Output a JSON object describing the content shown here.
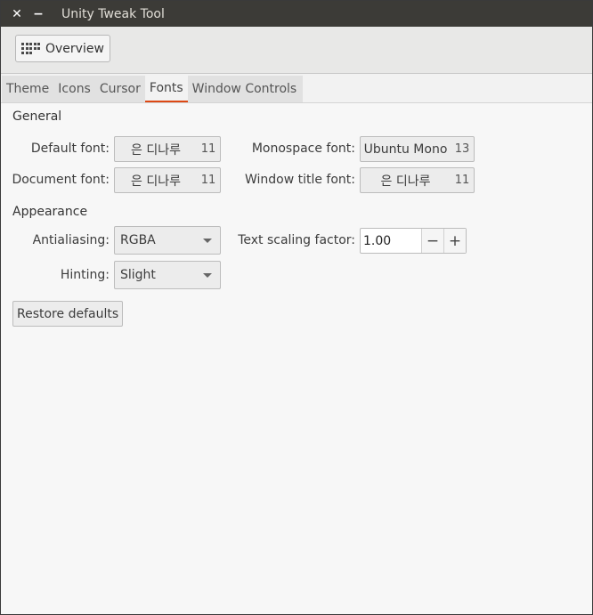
{
  "window": {
    "title": "Unity Tweak Tool",
    "close_glyph": "✕",
    "minimize_glyph": "−"
  },
  "toolbar": {
    "overview_label": "Overview",
    "overview_icon": "grid-icon"
  },
  "tabs": [
    {
      "label": "Theme",
      "active": false
    },
    {
      "label": "Icons",
      "active": false
    },
    {
      "label": "Cursor",
      "active": false
    },
    {
      "label": "Fonts",
      "active": true
    },
    {
      "label": "Window Controls",
      "active": false
    }
  ],
  "general": {
    "heading": "General",
    "default_font": {
      "label": "Default font:",
      "name": "은 디나루",
      "size": "11"
    },
    "document_font": {
      "label": "Document font:",
      "name": "은 디나루",
      "size": "11"
    },
    "monospace_font": {
      "label": "Monospace font:",
      "name": "Ubuntu Mono",
      "size": "13"
    },
    "window_title_font": {
      "label": "Window title font:",
      "name": "은 디나루",
      "size": "11"
    }
  },
  "appearance": {
    "heading": "Appearance",
    "antialiasing": {
      "label": "Antialiasing:",
      "value": "RGBA"
    },
    "hinting": {
      "label": "Hinting:",
      "value": "Slight"
    },
    "text_scaling": {
      "label": "Text scaling factor:",
      "value": "1.00",
      "minus": "−",
      "plus": "+"
    }
  },
  "restore_label": "Restore defaults",
  "colors": {
    "titlebar": "#3c3b37",
    "tab_underline": "#dd4814",
    "background": "#f7f7f7"
  }
}
